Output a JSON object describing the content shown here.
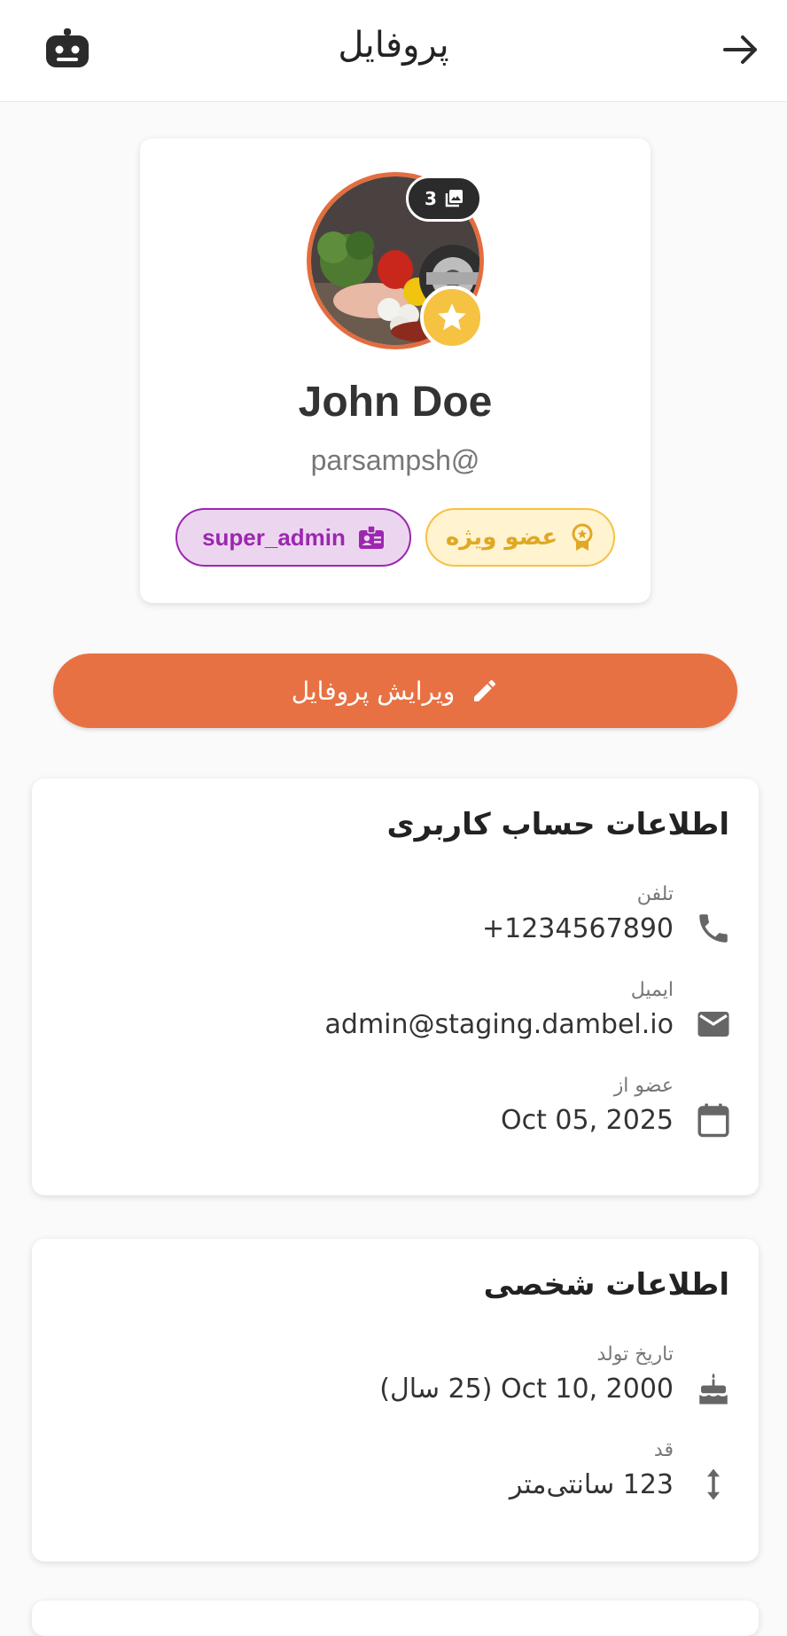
{
  "app_bar": {
    "title": "پروفایل",
    "left_icon": "robot-icon",
    "right_icon": "arrow-forward-icon"
  },
  "profile": {
    "photo_count": "3",
    "name": "John Doe",
    "handle": "parsampsh@",
    "role_chip": "super_admin",
    "premium_chip": "عضو ویژه"
  },
  "edit_button": {
    "label": "ویرایش پروفایل"
  },
  "account_info": {
    "title": "اطلاعات حساب کاربری",
    "rows": [
      {
        "label": "تلفن",
        "value": "1234567890+",
        "icon": "phone-icon"
      },
      {
        "label": "ایمیل",
        "value": "admin@staging.dambel.io",
        "icon": "email-icon"
      },
      {
        "label": "عضو از",
        "value": "Oct 05, 2025",
        "icon": "calendar-icon"
      }
    ]
  },
  "personal_info": {
    "title": "اطلاعات شخصی",
    "rows": [
      {
        "label": "تاریخ تولد",
        "value": "Oct 10, 2000 (25 سال)",
        "icon": "cake-icon"
      },
      {
        "label": "قد",
        "value": "123 سانتی‌متر",
        "icon": "height-icon"
      }
    ]
  },
  "colors": {
    "accent": "#e87143",
    "admin_chip": "#9c27b0",
    "premium": "#f5c242"
  }
}
